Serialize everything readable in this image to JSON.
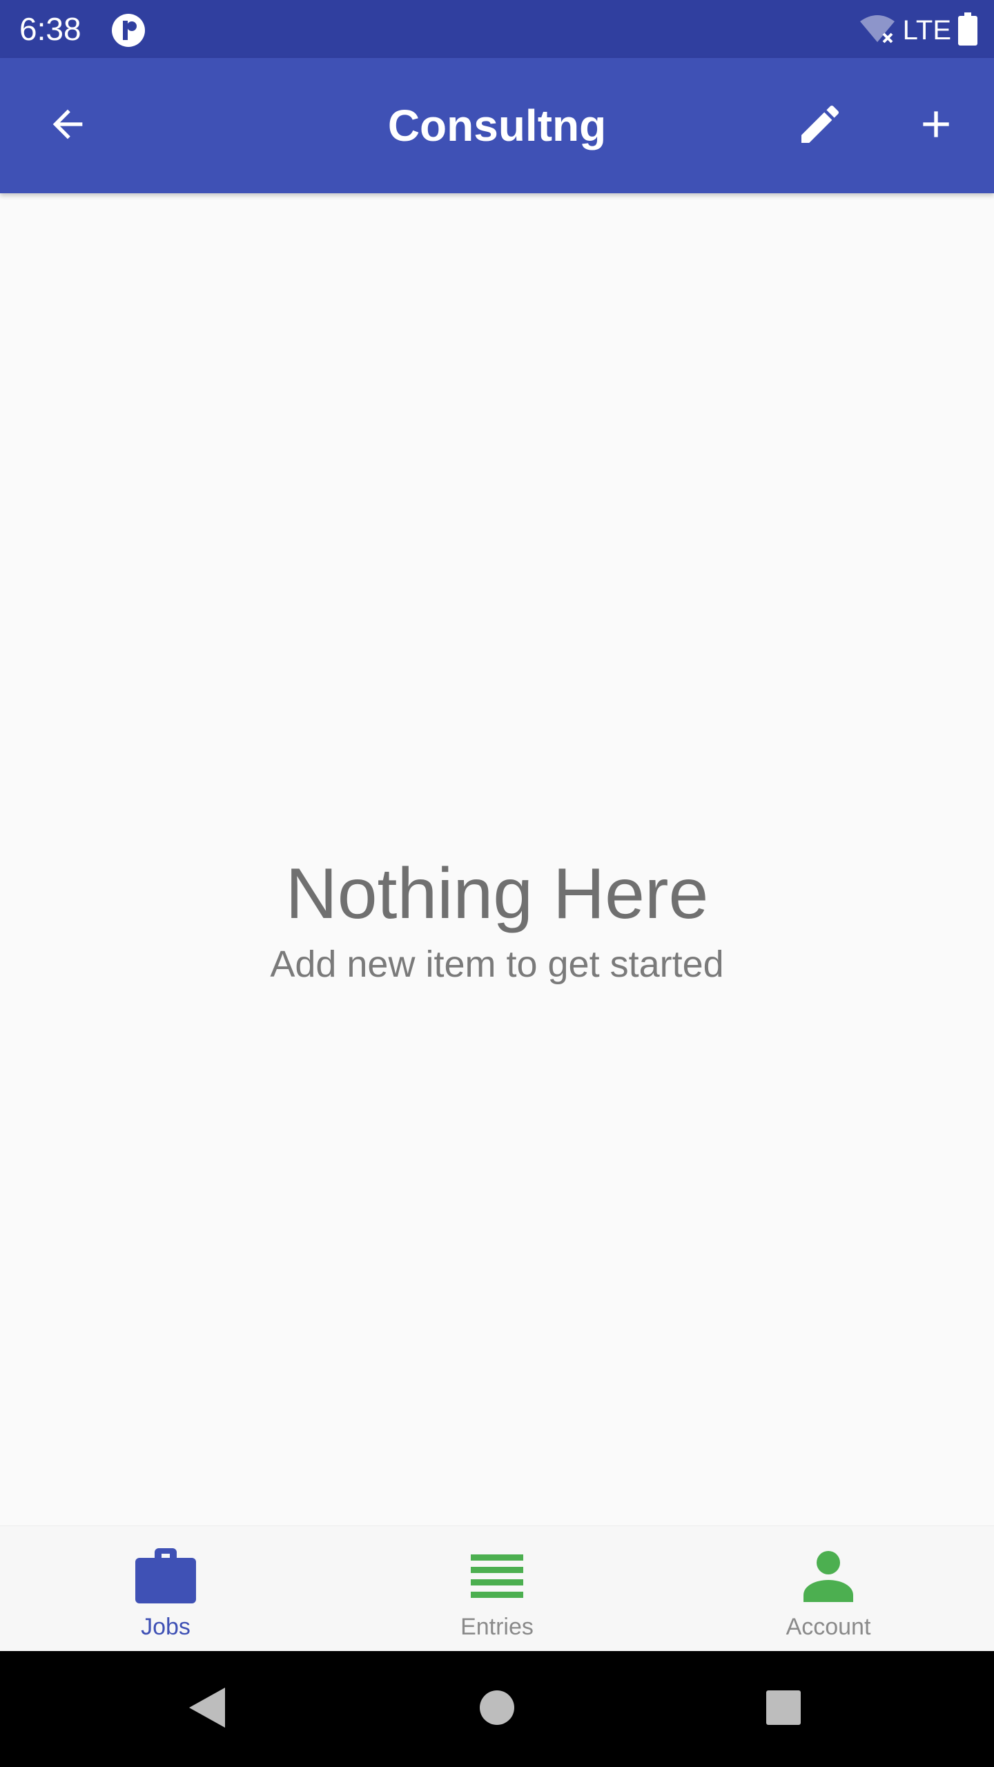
{
  "status_bar": {
    "time": "6:38",
    "network": "LTE",
    "icons": [
      "notification-app-icon",
      "wifi-off-icon",
      "battery-icon"
    ]
  },
  "app_bar": {
    "title": "Consultng",
    "back_icon": "arrow-left-icon",
    "edit_icon": "pencil-icon",
    "add_icon": "plus-icon"
  },
  "empty_state": {
    "title": "Nothing Here",
    "subtitle": "Add new item to get started"
  },
  "bottom_nav": {
    "items": [
      {
        "label": "Jobs",
        "icon": "briefcase-icon",
        "active": true
      },
      {
        "label": "Entries",
        "icon": "list-icon",
        "active": false
      },
      {
        "label": "Account",
        "icon": "person-icon",
        "active": false
      }
    ]
  },
  "colors": {
    "primary": "#3f51b5",
    "primary_dark": "#303f9f",
    "accent_green": "#4caf50",
    "text_muted": "#707070"
  }
}
